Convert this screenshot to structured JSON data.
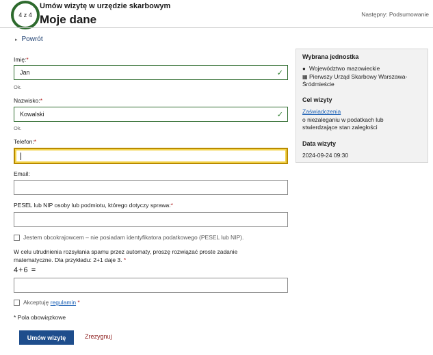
{
  "header": {
    "step_indicator": "4 z 4",
    "process_title": "Umów wizytę w urzędzie skarbowym",
    "page_title": "Moje dane",
    "next_step": "Następny: Podsumowanie"
  },
  "nav": {
    "back_label": "Powrót"
  },
  "form": {
    "first_name": {
      "label": "Imię:",
      "required_mark": "*",
      "value": "Jan",
      "hint": "Ok."
    },
    "last_name": {
      "label": "Nazwisko:",
      "required_mark": "*",
      "value": "Kowalski",
      "hint": "Ok."
    },
    "phone": {
      "label": "Telefon:",
      "required_mark": "*",
      "value": ""
    },
    "email": {
      "label": "Email:",
      "value": ""
    },
    "pesel": {
      "label": "PESEL lub NIP osoby lub podmiotu, którego dotyczy sprawa:",
      "required_mark": "*",
      "value": ""
    },
    "foreigner_checkbox": {
      "label": "Jestem obcokrajowcem – nie posiadam identyfikatora podatkowego (PESEL lub NIP).",
      "checked": false
    },
    "captcha": {
      "instruction": "W celu utrudnienia rozsyłania spamu przez automaty, proszę rozwiązać proste zadanie matematyczne. Dla przykładu: 2+1 daje 3.",
      "required_mark": "*",
      "expression": "4+6 =",
      "value": ""
    },
    "terms": {
      "prefix": "Akceptuję",
      "link": "regulamin",
      "required_mark": "*",
      "checked": false
    },
    "required_note": "* Pola obowiązkowe",
    "submit_label": "Umów wizytę",
    "cancel_label": "Zrezygnuj"
  },
  "summary_panel": {
    "unit_heading": "Wybrana jednostka",
    "voivodeship": "Województwo mazowieckie",
    "office": "Pierwszy Urząd Skarbowy Warszawa-Śródmieście",
    "purpose_heading": "Cel wizyty",
    "purpose_link": "Zaświadczenia",
    "purpose_text": "o niezaleganiu w podatkach lub stwierdzające stan zaległości",
    "date_heading": "Data wizyty",
    "date_value": "2024-09-24 09:30"
  },
  "colors": {
    "accent_green": "#2d6a2d",
    "primary_blue": "#1e4d8c",
    "focus_yellow": "#f3d34a",
    "required_red": "#b22222"
  },
  "icons": [
    "check-icon",
    "location-pin-icon",
    "building-icon",
    "chevron-right-icon"
  ]
}
